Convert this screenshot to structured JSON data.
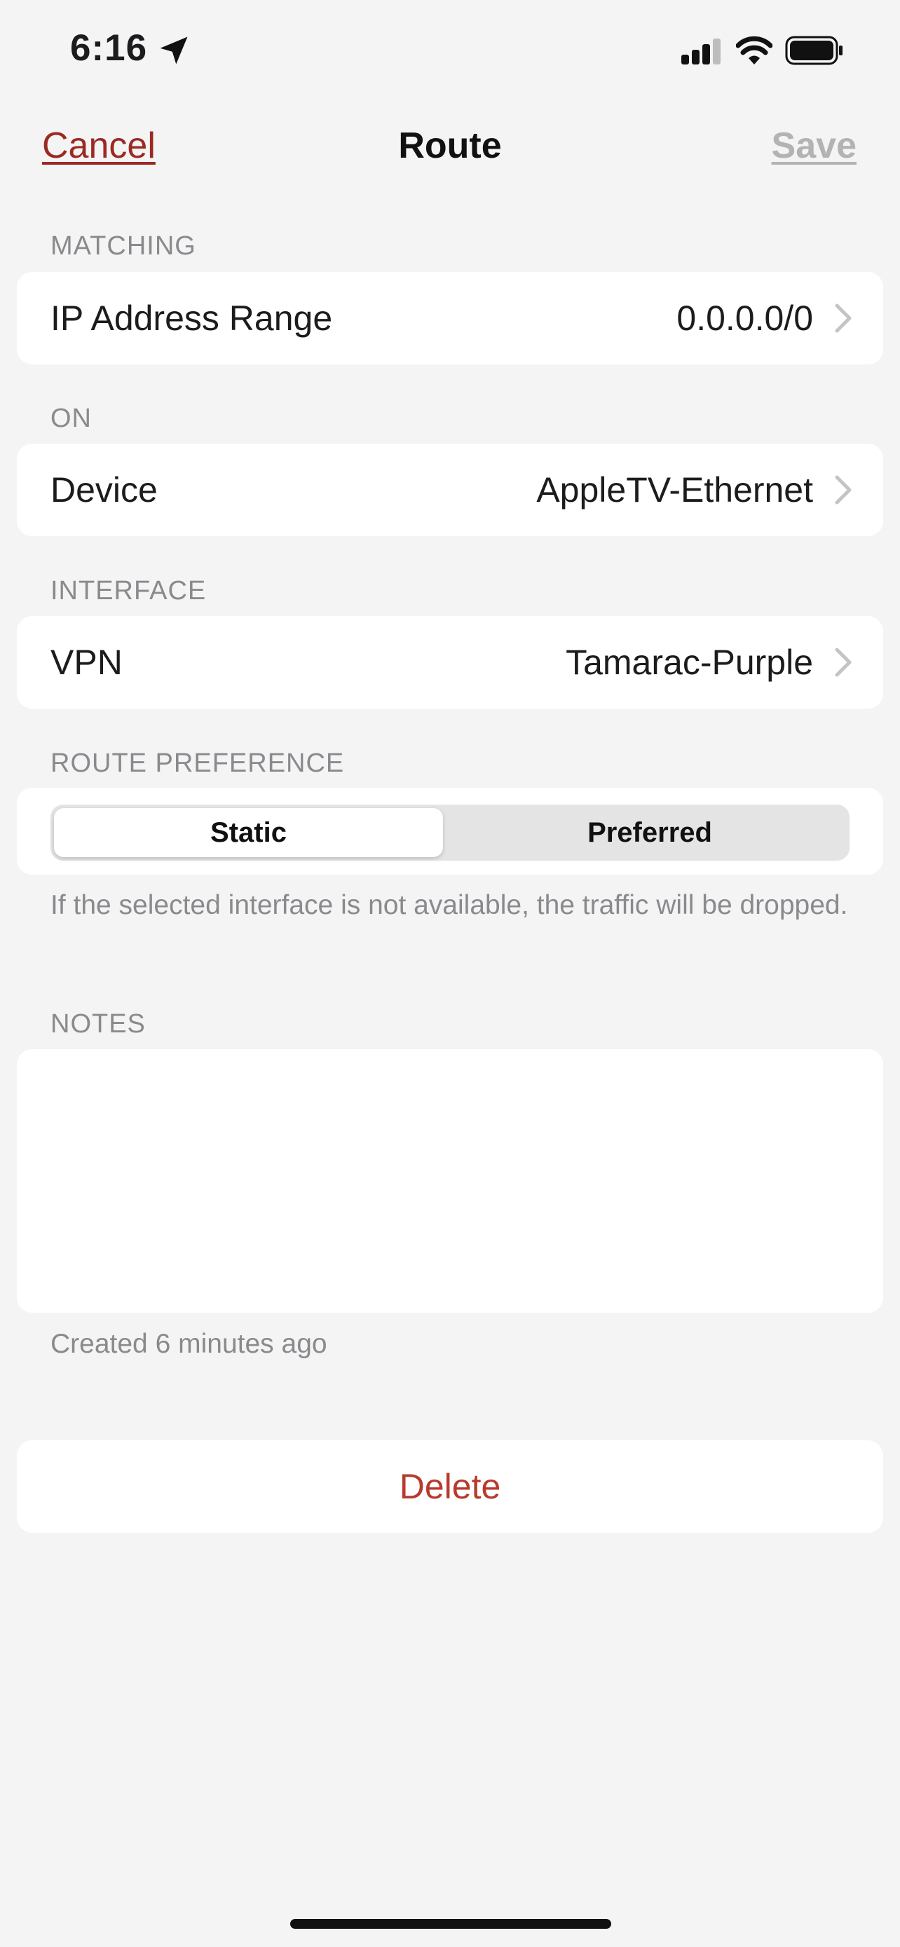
{
  "status_bar": {
    "time": "6:16",
    "icons": [
      "location-arrow-icon",
      "cellular-signal-icon",
      "wifi-icon",
      "battery-icon"
    ]
  },
  "nav": {
    "cancel_label": "Cancel",
    "title": "Route",
    "save_label": "Save"
  },
  "sections": {
    "matching": {
      "header": "MATCHING",
      "row_label": "IP Address Range",
      "row_value": "0.0.0.0/0"
    },
    "on": {
      "header": "ON",
      "row_label": "Device",
      "row_value": "AppleTV-Ethernet"
    },
    "interface": {
      "header": "INTERFACE",
      "row_label": "VPN",
      "row_value": "Tamarac-Purple"
    },
    "route_preference": {
      "header": "ROUTE PREFERENCE",
      "options": [
        "Static",
        "Preferred"
      ],
      "selected": "Static",
      "footnote": "If the selected interface is not available, the traffic will be dropped."
    },
    "notes": {
      "header": "NOTES",
      "value": "",
      "created": "Created 6 minutes ago"
    }
  },
  "delete_label": "Delete",
  "colors": {
    "accent": "#9b2a22",
    "destructive": "#b73a2e",
    "background": "#f4f4f4",
    "disabled": "#b3b3b3"
  }
}
